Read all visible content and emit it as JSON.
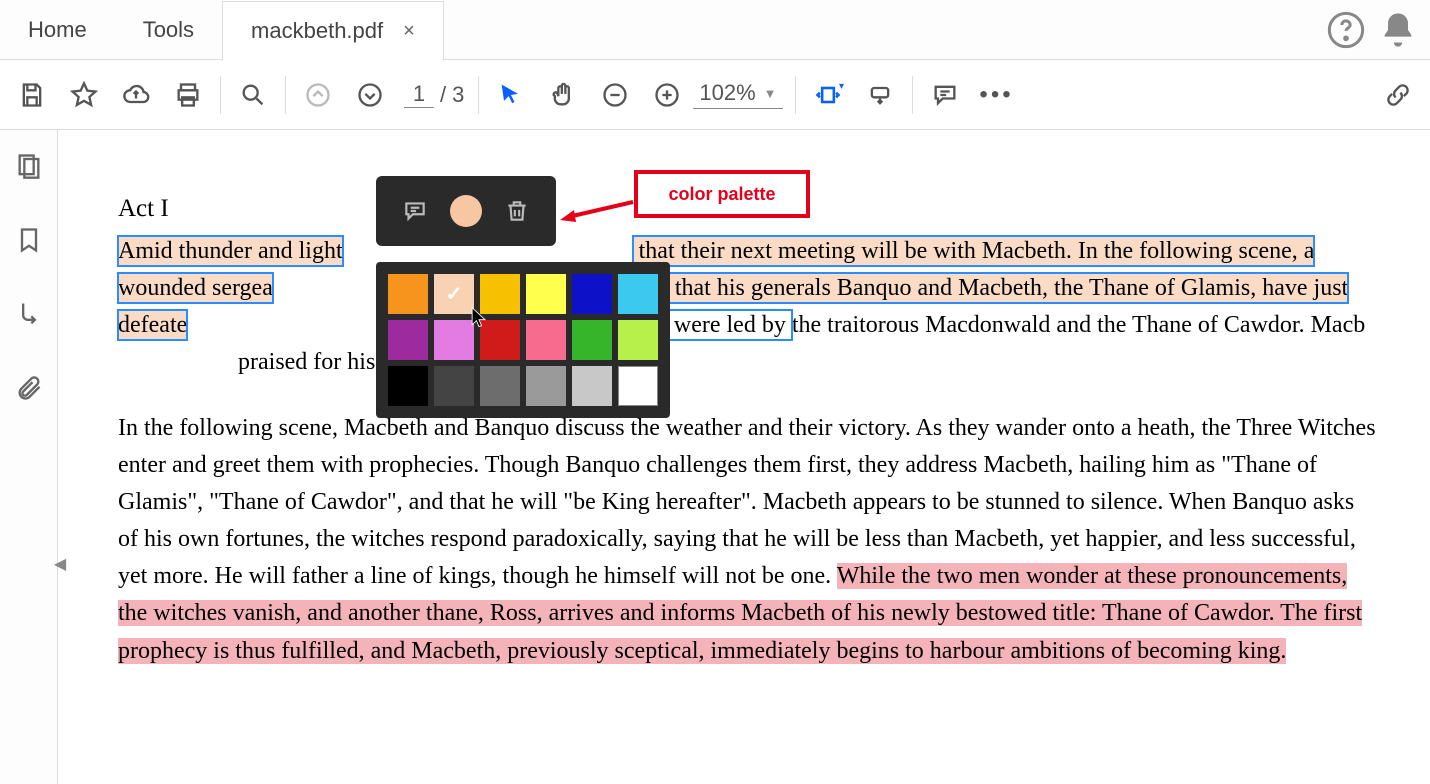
{
  "tabs": {
    "home": "Home",
    "tools": "Tools",
    "file": "mackbeth.pdf"
  },
  "toolbar": {
    "page_current": "1",
    "page_sep": "/",
    "page_total": "3",
    "zoom": "102%"
  },
  "document": {
    "heading": "Act I",
    "p1": {
      "a": "Amid thunder and light",
      "b": " that their next meeting will be with Macbeth. In the following scene, a wounded sergea",
      "c": " of Scotland that his generals Banquo and Macbeth, the Thane of Glamis, have just defeate",
      "d": "ay and Ireland, who were led by ",
      "e": "the traitorous Macdonwald and the Thane of Cawdor. Macb",
      "f": "praised for his bravery and fighting prowess."
    },
    "p2": {
      "a": "In the following scene, Macbeth and Banquo discuss the weather and their victory. As they wander onto a heath, the Three Witches enter and greet them with prophecies. Though Banquo challenges them first, they address Macbeth, hailing him as \"Thane of Glamis\", \"Thane of Cawdor\", and that he will \"be King hereafter\". Macbeth appears to be stunned to silence. When Banquo asks of his own fortunes, the witches respond paradoxically, saying that he will be less than Macbeth, yet happier, and less successful, yet more. He will father a line of kings, though he himself will not be one. ",
      "b": "While the two men wonder at these pronouncements, the witches vanish, and another thane, Ross, arrives and informs Macbeth of his newly bestowed title: Thane of Cawdor. The first prophecy is thus fulfilled, and Macbeth, previously sceptical, immediately begins to harbour ambitions of becoming king."
    }
  },
  "palette": {
    "colors": [
      "#f7941e",
      "#f9d2b4",
      "#f7c000",
      "#ffff4d",
      "#0d12c9",
      "#3bc9f0",
      "#9d2b9d",
      "#e27be2",
      "#d11a1a",
      "#f76b8f",
      "#37b52a",
      "#b7f04a",
      "#000000",
      "#444444",
      "#6d6d6d",
      "#9a9a9a",
      "#c8c8c8",
      "#ffffff"
    ],
    "selected_index": 1
  },
  "callout": "color palette"
}
